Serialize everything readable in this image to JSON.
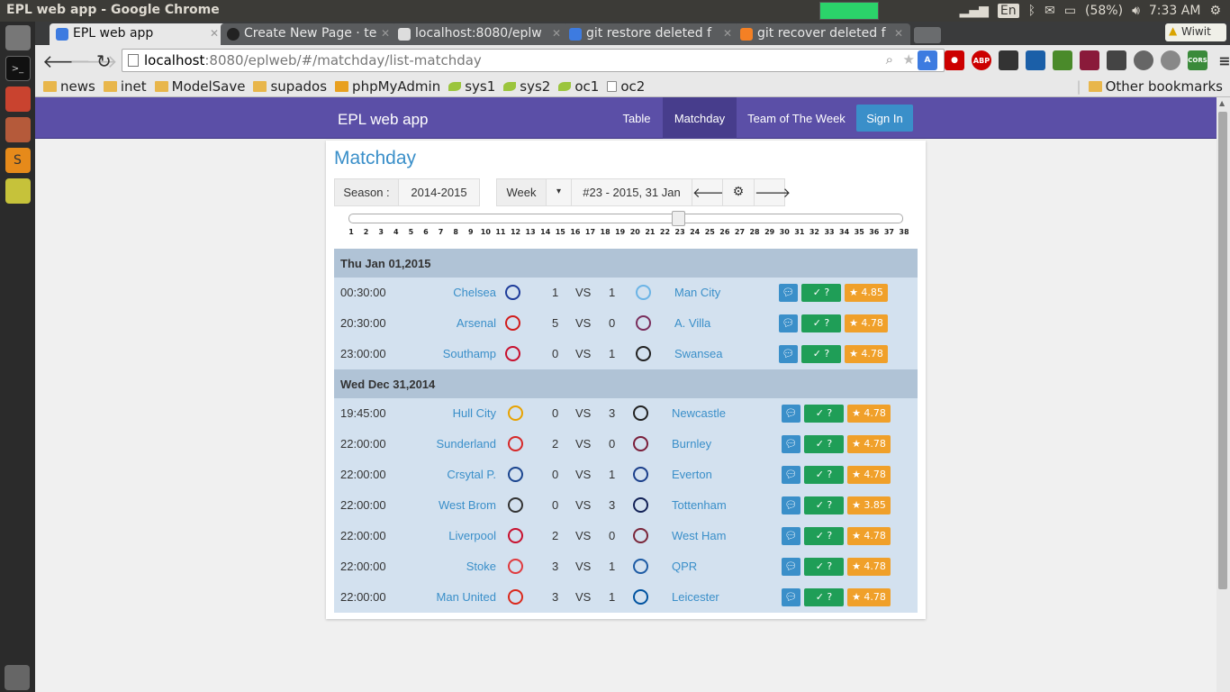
{
  "os": {
    "window_title": "EPL web app - Google Chrome",
    "keyboard": "En",
    "battery": "(58%)",
    "clock": "7:33 AM"
  },
  "browser": {
    "tabs": [
      {
        "label": "EPL web app",
        "active": true
      },
      {
        "label": "Create New Page · te",
        "active": false
      },
      {
        "label": "localhost:8080/eplw",
        "active": false
      },
      {
        "label": "git restore deleted f",
        "active": false
      },
      {
        "label": "git recover deleted f",
        "active": false
      }
    ],
    "profile_label": "Wiwit",
    "url_host": "localhost",
    "url_path": ":8080/eplweb/#/matchday/list-matchday",
    "bookmarks": [
      {
        "label": "news",
        "icon": "folder"
      },
      {
        "label": "inet",
        "icon": "folder"
      },
      {
        "label": "ModelSave",
        "icon": "folder"
      },
      {
        "label": "supados",
        "icon": "folder"
      },
      {
        "label": "phpMyAdmin",
        "icon": "pma"
      },
      {
        "label": "sys1",
        "icon": "leaf"
      },
      {
        "label": "sys2",
        "icon": "leaf"
      },
      {
        "label": "oc1",
        "icon": "leaf"
      },
      {
        "label": "oc2",
        "icon": "page"
      }
    ],
    "other_bookmarks": "Other bookmarks",
    "extensions": [
      "ABP",
      "CORS"
    ]
  },
  "app": {
    "brand": "EPL web app",
    "nav": {
      "table": "Table",
      "matchday": "Matchday",
      "team_of_week": "Team of The Week",
      "signin": "Sign In"
    },
    "page_title": "Matchday",
    "season_label": "Season :",
    "season_value": "2014-2015",
    "mode_label": "Week",
    "caret": "▾",
    "week_value": "#23 - 2015, 31 Jan",
    "prev_icon": "arrow-left",
    "settings_icon": "gear",
    "next_icon": "arrow-right",
    "slider": {
      "min": 1,
      "max": 38,
      "value": 23
    },
    "ticks": [
      "1",
      "2",
      "3",
      "4",
      "5",
      "6",
      "7",
      "8",
      "9",
      "10",
      "11",
      "12",
      "13",
      "14",
      "15",
      "16",
      "17",
      "18",
      "19",
      "20",
      "21",
      "22",
      "23",
      "24",
      "25",
      "26",
      "27",
      "28",
      "29",
      "30",
      "31",
      "32",
      "33",
      "34",
      "35",
      "36",
      "37",
      "38"
    ],
    "vs": "VS",
    "check_label": "✓ ?",
    "days": [
      {
        "date": "Thu Jan 01,2015",
        "matches": [
          {
            "time": "00:30:00",
            "home": "Chelsea",
            "hs": "1",
            "as": "1",
            "away": "Man City",
            "rating": "4.85",
            "hc": "#1e3c9a",
            "ac": "#6cb4e6"
          },
          {
            "time": "20:30:00",
            "home": "Arsenal",
            "hs": "5",
            "as": "0",
            "away": "A. Villa",
            "rating": "4.78",
            "hc": "#d11c1c",
            "ac": "#7a2f5d"
          },
          {
            "time": "23:00:00",
            "home": "Southamp",
            "hs": "0",
            "as": "1",
            "away": "Swansea",
            "rating": "4.78",
            "hc": "#c8102e",
            "ac": "#222222"
          }
        ]
      },
      {
        "date": "Wed Dec 31,2014",
        "matches": [
          {
            "time": "19:45:00",
            "home": "Hull City",
            "hs": "0",
            "as": "3",
            "away": "Newcastle",
            "rating": "4.78",
            "hc": "#e8a200",
            "ac": "#222222"
          },
          {
            "time": "22:00:00",
            "home": "Sunderland",
            "hs": "2",
            "as": "0",
            "away": "Burnley",
            "rating": "4.78",
            "hc": "#d62828",
            "ac": "#7a1e3a"
          },
          {
            "time": "22:00:00",
            "home": "Crsytal P.",
            "hs": "0",
            "as": "1",
            "away": "Everton",
            "rating": "4.78",
            "hc": "#1b458f",
            "ac": "#1b3f8b"
          },
          {
            "time": "22:00:00",
            "home": "West Brom",
            "hs": "0",
            "as": "3",
            "away": "Tottenham",
            "rating": "3.85",
            "hc": "#333333",
            "ac": "#132257"
          },
          {
            "time": "22:00:00",
            "home": "Liverpool",
            "hs": "2",
            "as": "0",
            "away": "West Ham",
            "rating": "4.78",
            "hc": "#c8102e",
            "ac": "#7a263a"
          },
          {
            "time": "22:00:00",
            "home": "Stoke",
            "hs": "3",
            "as": "1",
            "away": "QPR",
            "rating": "4.78",
            "hc": "#e03a3e",
            "ac": "#1d5ba4"
          },
          {
            "time": "22:00:00",
            "home": "Man United",
            "hs": "3",
            "as": "1",
            "away": "Leicester",
            "rating": "4.78",
            "hc": "#da291c",
            "ac": "#0053a0"
          }
        ]
      }
    ]
  }
}
